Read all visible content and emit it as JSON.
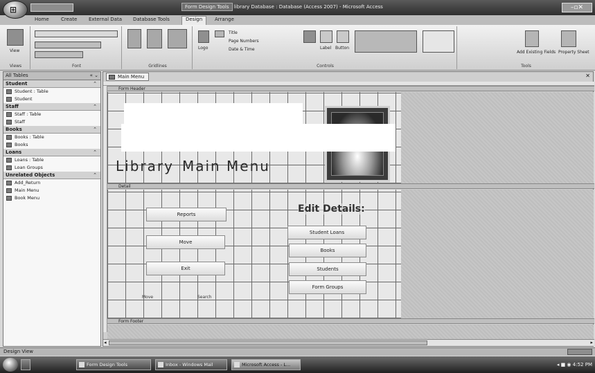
{
  "titlebar": {
    "contextual": "Form Design Tools",
    "title": "library Database : Database (Access 2007) - Microsoft Access"
  },
  "ribbon_tabs": [
    "Home",
    "Create",
    "External Data",
    "Database Tools",
    "Design",
    "Arrange"
  ],
  "ribbon_groups": [
    "Views",
    "Font",
    "Gridlines",
    "Controls",
    "Tools"
  ],
  "ribbon_labels": {
    "view": "View",
    "logo": "Logo",
    "title": "Title",
    "page_numbers": "Page Numbers",
    "date_time": "Date & Time",
    "label": "Label",
    "button": "Button",
    "add_existing_fields": "Add Existing Fields",
    "property_sheet": "Property Sheet"
  },
  "nav": {
    "header": "All Tables",
    "groups": [
      {
        "name": "Student",
        "items": [
          "Student : Table",
          "Student"
        ]
      },
      {
        "name": "Staff",
        "items": [
          "Staff : Table",
          "Staff"
        ]
      },
      {
        "name": "Books",
        "items": [
          "Books : Table",
          "Books"
        ]
      },
      {
        "name": "Loans",
        "items": [
          "Loans : Table",
          "Loan Groups"
        ]
      },
      {
        "name": "Unrelated Objects",
        "items": [
          "Add_Return",
          "Main Menu",
          "Book Menu"
        ]
      }
    ]
  },
  "document": {
    "tab": "Main Menu",
    "form_header": "Form Header",
    "detail": "Detail",
    "form_footer": "Form Footer",
    "title_words": [
      "Library",
      "Main",
      "Menu"
    ],
    "left_buttons": [
      "Reports",
      "Move",
      "Exit"
    ],
    "edit_label": "Edit Details:",
    "right_buttons": [
      "Student Loans",
      "Books",
      "Students",
      "Form Groups"
    ],
    "small_labels": [
      "Move",
      "Search"
    ]
  },
  "status": {
    "text": "Design View"
  },
  "taskbar": {
    "buttons": [
      "Form Design Tools",
      "Inbox - Windows Mail",
      "Microsoft Access - L..."
    ],
    "clock": "4:52 PM"
  }
}
